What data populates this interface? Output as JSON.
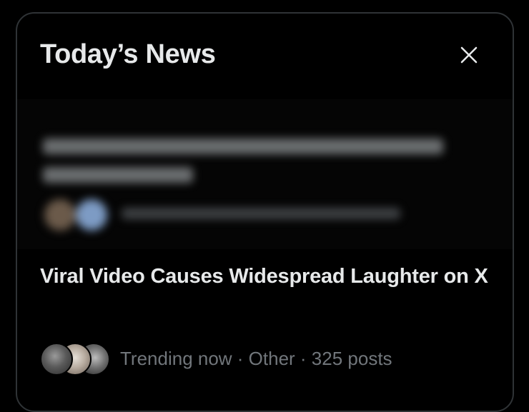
{
  "panel": {
    "title": "Today’s News",
    "close_label": "Close"
  },
  "stories": [
    {
      "headline": "Viral Video Causes Widespread Laughter on X",
      "meta": "Trending now · Other · 325 posts"
    }
  ],
  "icons": {
    "close": "close-icon",
    "avatars": [
      "avatar-1",
      "avatar-2",
      "avatar-3"
    ]
  },
  "colors": {
    "background": "#000000",
    "border": "#2f3336",
    "primary_text": "#e7e9ea",
    "secondary_text": "#71767b"
  }
}
